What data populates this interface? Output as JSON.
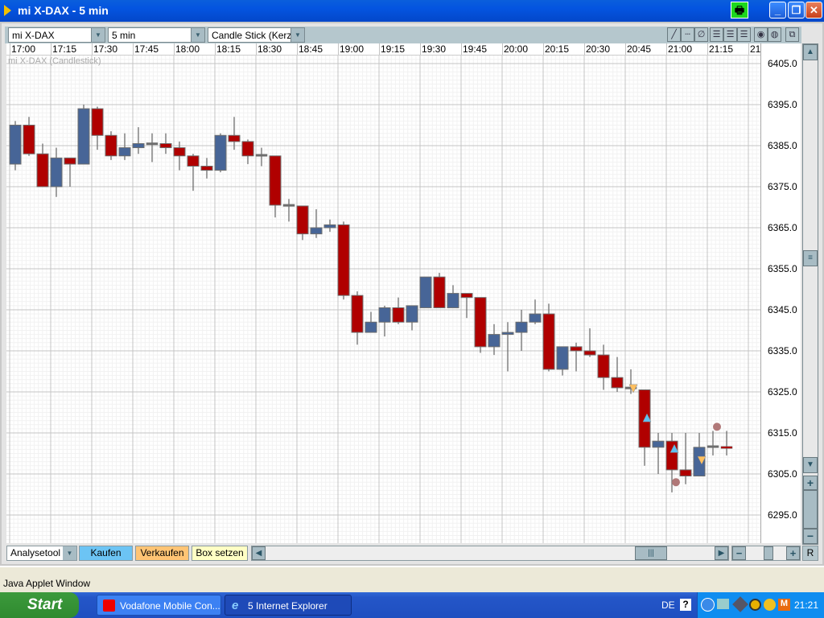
{
  "window": {
    "title": "mi X-DAX - 5 min",
    "minimize": "_",
    "maximize": "❐",
    "close": "✕",
    "print": "🖶"
  },
  "toolbar": {
    "instrument": "mi X-DAX",
    "interval": "5 min",
    "chart_type": "Candle Stick (Kerzen",
    "dropdown_arrow": "▼",
    "tools": [
      "╱",
      "┄",
      "∅",
      "☰",
      "☰",
      "☰",
      "◉",
      "◍",
      "⧉"
    ]
  },
  "chart": {
    "caption": "mi X-DAX (Candlestick)",
    "time_labels": [
      "17:00",
      "17:15",
      "17:30",
      "17:45",
      "18:00",
      "18:15",
      "18:30",
      "18:45",
      "19:00",
      "19:15",
      "19:30",
      "19:45",
      "20:00",
      "20:15",
      "20:30",
      "20:45",
      "21:00",
      "21:15",
      "21"
    ],
    "price_labels": [
      "6405.0",
      "6395.0",
      "6385.0",
      "6375.0",
      "6365.0",
      "6355.0",
      "6345.0",
      "6335.0",
      "6325.0",
      "6315.0",
      "6305.0",
      "6295.0"
    ]
  },
  "chart_data": {
    "type": "candlestick",
    "title": "mi X-DAX (Candlestick)",
    "interval": "5 min",
    "ylim": [
      6293,
      6407
    ],
    "up_color": "#476597",
    "down_color": "#b00000",
    "candles": [
      [
        6380.5,
        6390,
        6391,
        6379
      ],
      [
        6390,
        6383,
        6392,
        6382.5
      ],
      [
        6383,
        6375,
        6385.5,
        6375
      ],
      [
        6375,
        6382,
        6384.5,
        6372.5
      ],
      [
        6382,
        6380.5,
        6382,
        6375
      ],
      [
        6380.5,
        6394,
        6395,
        6380.5
      ],
      [
        6394,
        6387.5,
        6394.5,
        6384
      ],
      [
        6387.5,
        6382.5,
        6388.5,
        6381.5
      ],
      [
        6382.5,
        6384.5,
        6388,
        6381.5
      ],
      [
        6384.5,
        6385.5,
        6389.5,
        6383
      ],
      [
        6385.3,
        6385.5,
        6388,
        6381
      ],
      [
        6385.5,
        6384.5,
        6388,
        6383
      ],
      [
        6384.5,
        6382.5,
        6386,
        6379
      ],
      [
        6382.5,
        6380,
        6383,
        6374
      ],
      [
        6380,
        6379,
        6382,
        6377
      ],
      [
        6379,
        6387.5,
        6388,
        6378.5
      ],
      [
        6387.5,
        6386,
        6392,
        6384
      ],
      [
        6386,
        6382.5,
        6386.5,
        6380.5
      ],
      [
        6382.5,
        6382.7,
        6384.5,
        6380
      ],
      [
        6382.5,
        6370.5,
        6382.5,
        6367.5
      ],
      [
        6370.5,
        6370.3,
        6372,
        6366.5
      ],
      [
        6370.3,
        6363.5,
        6370.3,
        6362
      ],
      [
        6363.5,
        6365,
        6369.5,
        6362.5
      ],
      [
        6365,
        6365.7,
        6367,
        6364
      ],
      [
        6365.7,
        6348.5,
        6366.5,
        6347.5
      ],
      [
        6348.5,
        6339.5,
        6349.5,
        6336.5
      ],
      [
        6339.5,
        6342,
        6344.5,
        6339.5
      ],
      [
        6342,
        6345.5,
        6346,
        6338.5
      ],
      [
        6345.5,
        6342,
        6348,
        6341.5
      ],
      [
        6342,
        6346,
        6346,
        6340
      ],
      [
        6345.5,
        6353,
        6353,
        6345.5
      ],
      [
        6353,
        6345.5,
        6354,
        6345.5
      ],
      [
        6345.5,
        6349,
        6351,
        6345.5
      ],
      [
        6349,
        6348,
        6349,
        6343
      ],
      [
        6348,
        6336,
        6348,
        6334.5
      ],
      [
        6336,
        6339,
        6341.5,
        6334
      ],
      [
        6339,
        6339.5,
        6342,
        6330
      ],
      [
        6339.5,
        6342,
        6345,
        6335
      ],
      [
        6342,
        6344,
        6347.5,
        6341.5
      ],
      [
        6344,
        6330.5,
        6346.5,
        6330
      ],
      [
        6330.5,
        6336,
        6336,
        6329
      ],
      [
        6336,
        6335,
        6337,
        6330
      ],
      [
        6335,
        6334,
        6340.5,
        6333.5
      ],
      [
        6334,
        6328.5,
        6336.5,
        6325.5
      ],
      [
        6328.5,
        6326,
        6333.5,
        6325
      ],
      [
        6326,
        6325.8,
        6330.5,
        6324.5
      ],
      [
        6325.5,
        6311.5,
        6325.5,
        6307
      ],
      [
        6311.5,
        6313,
        6315,
        6305
      ],
      [
        6313,
        6306,
        6315,
        6300.5
      ],
      [
        6306,
        6304.5,
        6315,
        6302.5
      ],
      [
        6304.5,
        6311.5,
        6315,
        6304.5
      ],
      [
        6311.5,
        6311.7,
        6315.5,
        6309.5
      ],
      [
        6311.5,
        6311.2,
        6315.5,
        6309.5
      ]
    ],
    "candle_fields": [
      "open",
      "close",
      "high",
      "low"
    ],
    "markers": [
      {
        "index": 45,
        "type": "sell",
        "price": 6326,
        "color": "#ffc060"
      },
      {
        "index": 46,
        "type": "buy",
        "price": 6318.5,
        "color": "#60c0f0"
      },
      {
        "index": 48,
        "type": "buy",
        "price": 6311,
        "color": "#60c0f0"
      },
      {
        "index": 48,
        "type": "circle",
        "price": 6303,
        "color": "#b07878"
      },
      {
        "index": 50,
        "type": "sell",
        "price": 6308.5,
        "color": "#ffc060"
      },
      {
        "index": 51,
        "type": "circle",
        "price": 6316.5,
        "color": "#b07878"
      }
    ]
  },
  "scroll": {
    "up": "▲",
    "down": "▼",
    "plus": "+",
    "minus": "−",
    "thumb": "≡",
    "left": "◀",
    "right": "▶",
    "hthumb": "|||",
    "reset": "R"
  },
  "bottom": {
    "analysis_tool": "Analysetool",
    "buy": "Kaufen",
    "sell": "Verkaufen",
    "box": "Box setzen"
  },
  "status": {
    "text": "Java Applet Window"
  },
  "taskbar": {
    "start": "Start",
    "tasks": [
      "Vodafone Mobile Con...",
      "5 Internet Explorer"
    ],
    "language": "DE",
    "help": "?",
    "clock": "21:21"
  }
}
